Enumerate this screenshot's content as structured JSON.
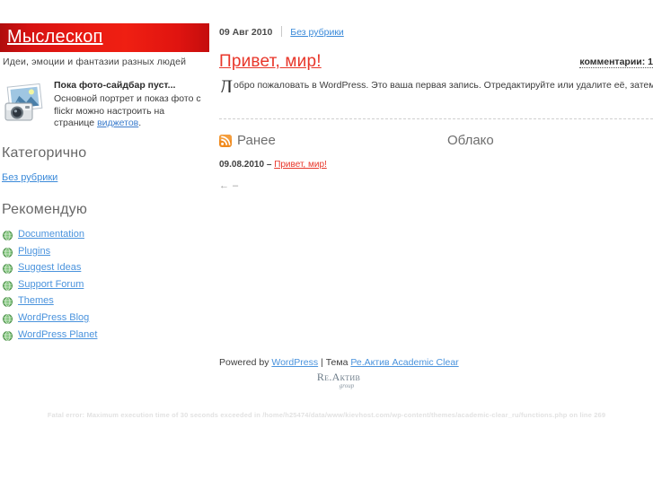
{
  "site": {
    "title": "Мыслескоп",
    "tagline": "Идеи, эмоции и фантазии разных людей"
  },
  "colors": {
    "banner_red": "#e81a12",
    "title_red": "#e8362a",
    "link_blue": "#3b8ad9",
    "rss_orange": "#f08a1e",
    "heading_gray": "#676767"
  },
  "photo_widget": {
    "icon": "photo-camera-icon",
    "title": "Пока фото-сайдбар пуст...",
    "text_line1": "Основной портрет и показ фото с flickr",
    "text_line2": "можно настроить на странице",
    "link_label": "виджетов",
    "text_tail": "."
  },
  "sidebar": {
    "categories_heading": "Категорично",
    "category_link": "Без рубрики",
    "blogroll_heading": "Рекомендую",
    "blogroll": [
      {
        "label": "Documentation",
        "icon": "globe-icon"
      },
      {
        "label": "Plugins",
        "icon": "globe-icon"
      },
      {
        "label": "Suggest Ideas",
        "icon": "globe-icon"
      },
      {
        "label": "Support Forum",
        "icon": "globe-icon"
      },
      {
        "label": "Themes",
        "icon": "globe-icon"
      },
      {
        "label": "WordPress Blog",
        "icon": "globe-icon"
      },
      {
        "label": "WordPress Planet",
        "icon": "globe-icon"
      }
    ]
  },
  "post": {
    "date": "09 Авг 2010",
    "category": "Без рубрики",
    "title": "Привет, мир!",
    "comments_label": "комментарии: 1",
    "dropcap": "Д",
    "body": "обро пожаловать в WordPress. Это ваша первая запись. Отредактируйте или удалите её, затем пишите!"
  },
  "recent": {
    "heading": "Ранее",
    "icon": "rss-icon",
    "items": [
      {
        "date": "09.08.2010",
        "dash": "–",
        "label": "Привет, мир!"
      }
    ],
    "pager_prev": "←",
    "pager_next": "–"
  },
  "cloud": {
    "heading": "Облако"
  },
  "footer": {
    "powered_prefix": "Powered by",
    "powered_link": "WordPress",
    "divider": "|",
    "theme_prefix": "Тема",
    "theme_link": "Ре.Актив Academic Clear",
    "logo_main": "Re.Актив",
    "logo_sub": "group"
  },
  "error": {
    "message": "Fatal error: Maximum execution time of 30 seconds exceeded in /home/h25474/data/www/kievhost.com/wp-content/themes/academic-clear_ru/functions.php on line 269"
  }
}
